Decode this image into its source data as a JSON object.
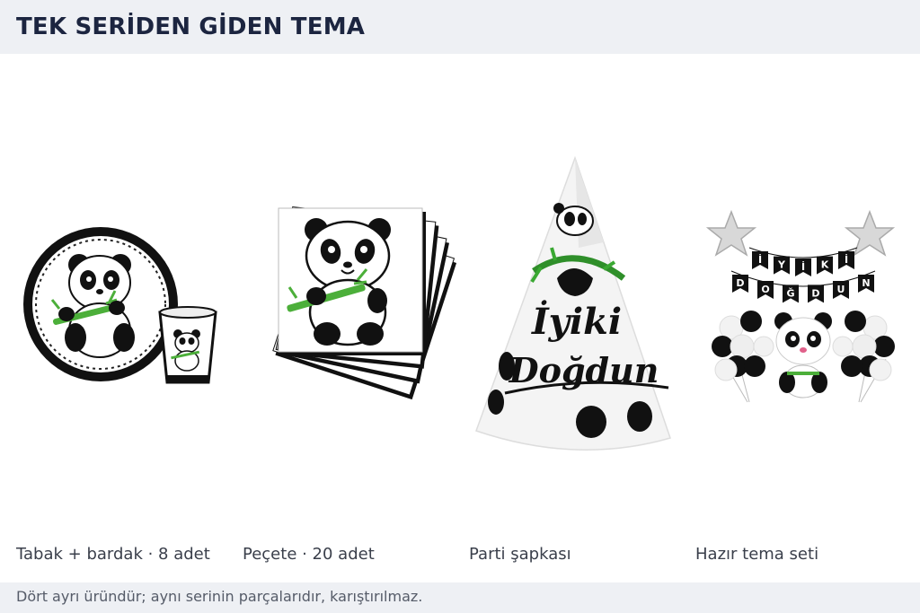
{
  "header": {
    "title": "TEK SERİDEN GİDEN TEMA"
  },
  "products": [
    {
      "caption": "Tabak + bardak · 8 adet",
      "icon": "panda-plate-cup-image"
    },
    {
      "caption": "Peçete · 20 adet",
      "icon": "panda-napkins-image"
    },
    {
      "caption": "Parti şapkası",
      "icon": "party-hat-image",
      "hat_text_line1": "İyiki",
      "hat_text_line2": "Doğdun"
    },
    {
      "caption": "Hazır tema seti",
      "icon": "balloon-set-image",
      "banner_letters": [
        "İ",
        "Y",
        "İ",
        "K",
        "İ"
      ],
      "banner_letters_2": [
        "D",
        "O",
        "Ğ",
        "D",
        "U",
        "N"
      ]
    }
  ],
  "footer": {
    "note": "Dört ayrı üründür; aynı serinin parçalarıdır, karıştırılmaz."
  }
}
